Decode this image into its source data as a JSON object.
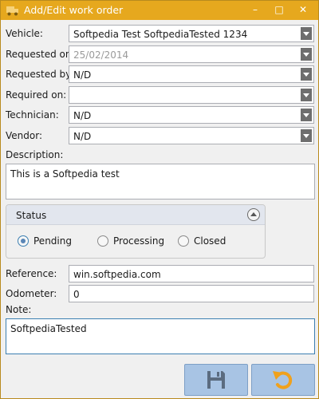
{
  "window": {
    "title": "Add/Edit work order",
    "buttons": [
      "–",
      "□",
      "✕"
    ]
  },
  "form": {
    "vehicle": {
      "label": "Vehicle:",
      "value": "Softpedia  Test  SoftpediaTested  1234"
    },
    "requested_on": {
      "label": "Requested on:",
      "value": "25/02/2014"
    },
    "requested_by": {
      "label": "Requested by:",
      "value": "N/D"
    },
    "required_on": {
      "label": "Required on:",
      "value": ""
    },
    "technician": {
      "label": "Technician:",
      "value": "N/D"
    },
    "vendor": {
      "label": "Vendor:",
      "value": "N/D"
    },
    "description": {
      "label": "Description:",
      "value": "This is a Softpedia test"
    },
    "reference": {
      "label": "Reference:",
      "value": "win.softpedia.com"
    },
    "odometer": {
      "label": "Odometer:",
      "value": "0"
    },
    "note": {
      "label": "Note:",
      "value": "SoftpediaTested"
    }
  },
  "status": {
    "header": "Status",
    "options": [
      {
        "label": "Pending",
        "selected": true
      },
      {
        "label": "Processing",
        "selected": false
      },
      {
        "label": "Closed",
        "selected": false
      }
    ]
  },
  "icons": {
    "app": "truck-icon",
    "save": "floppy-disk-icon",
    "undo": "undo-arrow-icon"
  },
  "colors": {
    "titlebar": "#e6a81e",
    "button": "#a8c4e4",
    "undo_arrow": "#f0a11c",
    "save_icon": "#5b6c80"
  }
}
